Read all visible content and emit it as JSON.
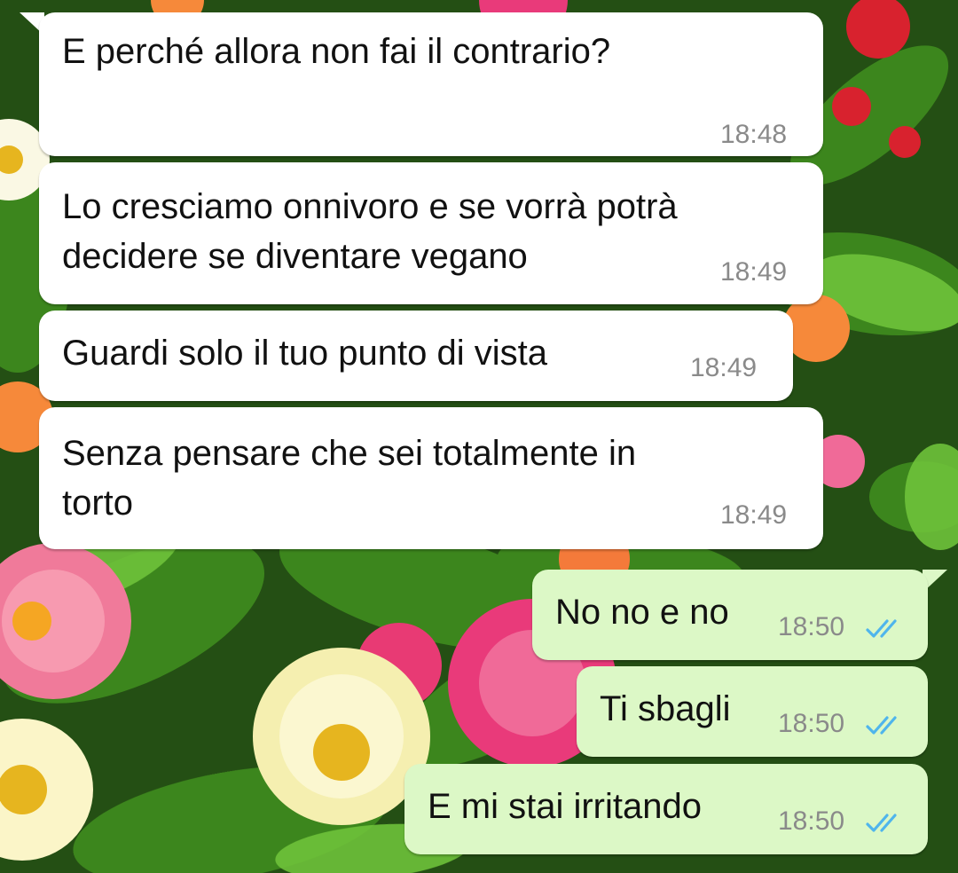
{
  "chat": {
    "messages": [
      {
        "direction": "incoming",
        "text": "E perché allora non fai il contrario?",
        "time": "18:48"
      },
      {
        "direction": "incoming",
        "text": "Lo cresciamo onnivoro e se vorrà potrà\ndecidere se diventare vegano",
        "time": "18:49"
      },
      {
        "direction": "incoming",
        "text": "Guardi solo il tuo punto di vista",
        "time": "18:49"
      },
      {
        "direction": "incoming",
        "text": "Senza pensare che sei totalmente in\ntorto",
        "time": "18:49"
      },
      {
        "direction": "outgoing",
        "text": "No no e no",
        "time": "18:50",
        "status": "read"
      },
      {
        "direction": "outgoing",
        "text": "Ti sbagli",
        "time": "18:50",
        "status": "read"
      },
      {
        "direction": "outgoing",
        "text": "E mi stai irritando",
        "time": "18:50",
        "status": "read"
      }
    ]
  },
  "colors": {
    "incoming_bubble": "#ffffff",
    "outgoing_bubble": "#dcf8c6",
    "read_ticks": "#4fb5ec",
    "timestamp": "#8a8a8a"
  },
  "icons": {
    "read_receipt": "double-check-icon",
    "wallpaper": "flowers-wallpaper"
  }
}
